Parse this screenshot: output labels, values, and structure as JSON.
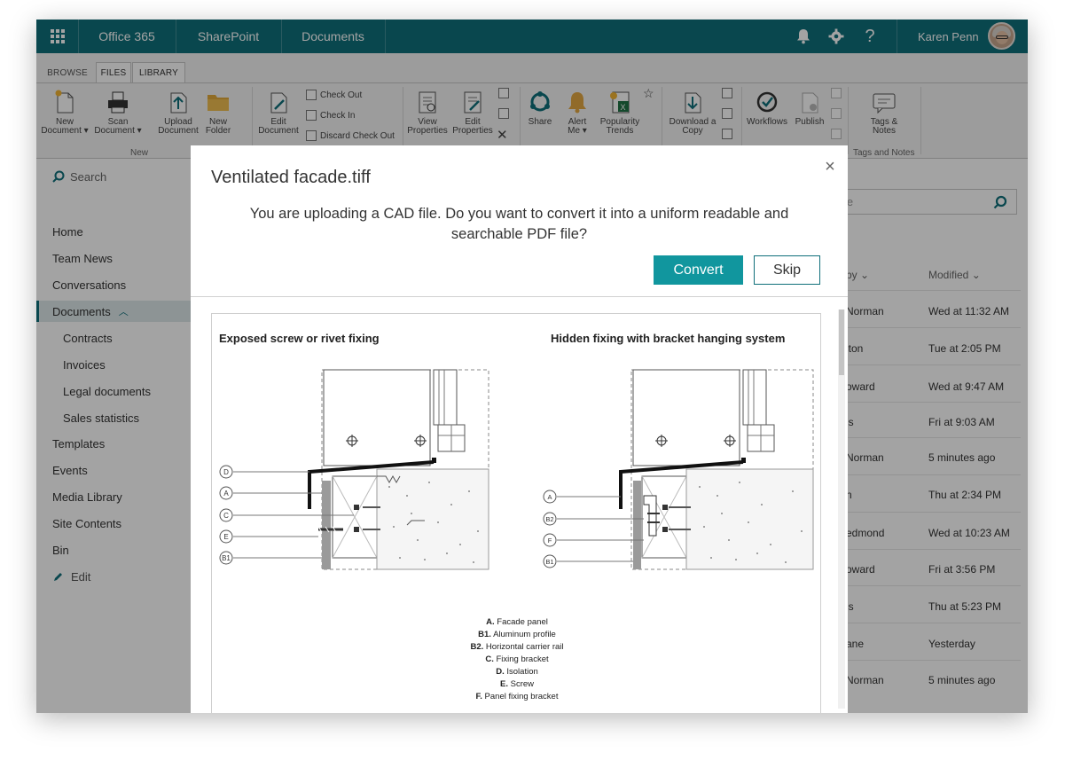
{
  "suitebar": {
    "app_launcher": "app-launcher",
    "office": "Office 365",
    "sharepoint": "SharePoint",
    "documents": "Documents",
    "user_name": "Karen Penn"
  },
  "ribbon": {
    "tabs": [
      "BROWSE",
      "FILES",
      "LIBRARY"
    ],
    "new_document": [
      "New",
      "Document ▾"
    ],
    "scan_document": [
      "Scan",
      "Document ▾"
    ],
    "upload_document": [
      "Upload",
      "Document"
    ],
    "new_folder": [
      "New",
      "Folder"
    ],
    "group_new": "New",
    "edit_document": [
      "Edit",
      "Document"
    ],
    "check_out": "Check Out",
    "check_in": "Check In",
    "discard_check_out": "Discard Check Out",
    "view_properties": [
      "View",
      "Properties"
    ],
    "edit_properties": [
      "Edit",
      "Properties"
    ],
    "share": "Share",
    "alert_me": [
      "Alert",
      "Me ▾"
    ],
    "popularity_trends": [
      "Popularity",
      "Trends"
    ],
    "download_copy": [
      "Download a",
      "Copy"
    ],
    "workflows": "Workflows",
    "publish": "Publish",
    "tags_notes": [
      "Tags &",
      "Notes"
    ],
    "group_tags_notes": "Tags and Notes"
  },
  "leftnav": {
    "search": "Search",
    "items": [
      "Home",
      "Team News",
      "Conversations",
      "Documents",
      "Contracts",
      "Invoices",
      "Legal documents",
      "Sales statistics",
      "Templates",
      "Events",
      "Media Library",
      "Site Contents",
      "Bin",
      "Edit"
    ]
  },
  "library": {
    "search_placeholder": "le",
    "col_modified_by": "by ⌄",
    "col_modified": "Modified ⌄",
    "rows": [
      {
        "by": "Norman",
        "modified": "Wed at  11:32 AM"
      },
      {
        "by": "lton",
        "modified": "Tue at  2:05 PM"
      },
      {
        "by": "oward",
        "modified": "Wed at  9:47 AM"
      },
      {
        "by": "is",
        "modified": "Fri at  9:03 AM"
      },
      {
        "by": "Norman",
        "modified": "5 minutes ago"
      },
      {
        "by": "n",
        "modified": "Thu at  2:34 PM"
      },
      {
        "by": "edmond",
        "modified": "Wed at  10:23 AM"
      },
      {
        "by": "oward",
        "modified": "Fri at  3:56 PM"
      },
      {
        "by": "is",
        "modified": "Thu at  5:23 PM"
      },
      {
        "by": "ane",
        "modified": "Yesterday"
      },
      {
        "by": "Norman",
        "modified": "5 minutes ago"
      }
    ]
  },
  "dialog": {
    "title": "Ventilated facade.tiff",
    "message": "You are uploading a CAD file. Do you want to convert it into a uniform readable and searchable PDF file?",
    "convert": "Convert",
    "skip": "Skip",
    "close": "×",
    "preview": {
      "left_title": "Exposed screw or rivet fixing",
      "right_title": "Hidden fixing with bracket hanging system",
      "left_callouts": [
        "D",
        "A",
        "C",
        "E",
        "B1"
      ],
      "right_callouts": [
        "A",
        "B2",
        "F",
        "B1"
      ],
      "legend": [
        {
          "key": "A.",
          "text": "Facade panel"
        },
        {
          "key": "B1.",
          "text": "Aluminum profile"
        },
        {
          "key": "B2.",
          "text": "Horizontal carrier rail"
        },
        {
          "key": "C.",
          "text": "Fixing bracket"
        },
        {
          "key": "D.",
          "text": "Isolation"
        },
        {
          "key": "E.",
          "text": "Screw"
        },
        {
          "key": "F.",
          "text": "Panel fixing bracket"
        }
      ]
    }
  },
  "colors": {
    "suitebar": "#0f6f7a",
    "accent": "#11969e",
    "overlay": "rgba(0,0,0,0.36)"
  }
}
